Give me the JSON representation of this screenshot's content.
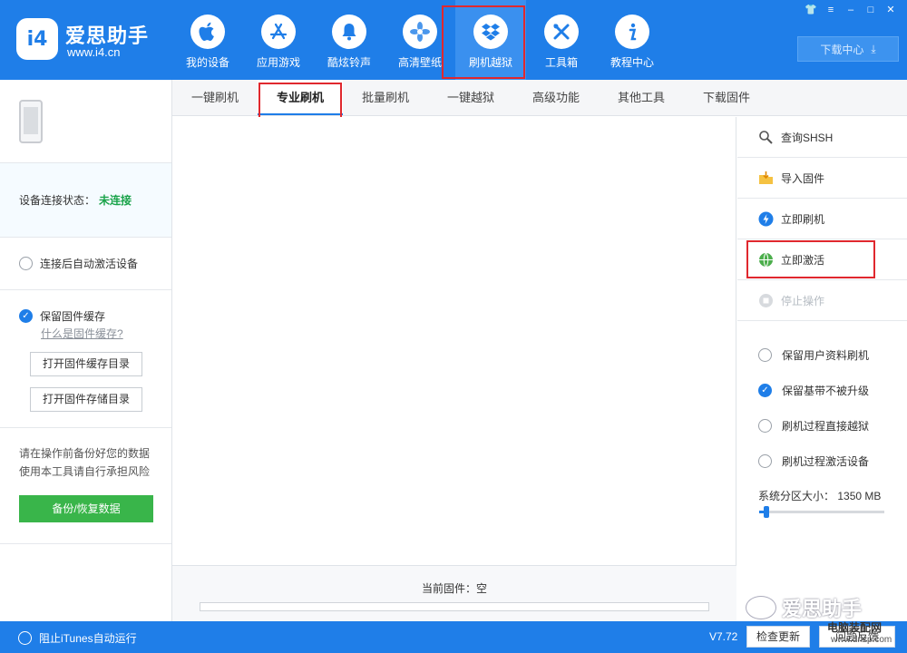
{
  "header": {
    "brand_name": "爱思助手",
    "brand_url": "www.i4.cn",
    "logo_text": "i4",
    "download_center": "下载中心",
    "nav": [
      {
        "label": "我的设备",
        "icon": "apple-icon"
      },
      {
        "label": "应用游戏",
        "icon": "app-store-icon"
      },
      {
        "label": "酷炫铃声",
        "icon": "bell-icon"
      },
      {
        "label": "高清壁纸",
        "icon": "flower-icon"
      },
      {
        "label": "刷机越狱",
        "icon": "dropbox-icon",
        "active": true
      },
      {
        "label": "工具箱",
        "icon": "tools-icon"
      },
      {
        "label": "教程中心",
        "icon": "info-icon"
      }
    ]
  },
  "sidebar": {
    "status_label": "设备连接状态：",
    "status_value": "未连接",
    "auto_activate": "连接后自动激活设备",
    "keep_cache": "保留固件缓存",
    "cache_help": "什么是固件缓存?",
    "open_cache_dir": "打开固件缓存目录",
    "open_storage_dir": "打开固件存储目录",
    "warning_line1": "请在操作前备份好您的数据",
    "warning_line2": "使用本工具请自行承担风险",
    "backup_button": "备份/恢复数据"
  },
  "tabs": [
    "一键刷机",
    "专业刷机",
    "批量刷机",
    "一键越狱",
    "高级功能",
    "其他工具",
    "下载固件"
  ],
  "active_tab": 1,
  "main": {
    "current_firmware": "当前固件：空"
  },
  "right_panel": {
    "actions": [
      {
        "label": "查询SHSH",
        "icon": "shsh-search-icon",
        "disabled": false
      },
      {
        "label": "导入固件",
        "icon": "import-folder-icon",
        "disabled": false
      },
      {
        "label": "立即刷机",
        "icon": "lightning-icon",
        "disabled": false
      },
      {
        "label": "立即激活",
        "icon": "globe-icon",
        "disabled": false
      },
      {
        "label": "停止操作",
        "icon": "stop-icon",
        "disabled": true
      }
    ],
    "options": [
      {
        "label": "保留用户资料刷机",
        "checked": false
      },
      {
        "label": "保留基带不被升级",
        "checked": true
      },
      {
        "label": "刷机过程直接越狱",
        "checked": false
      },
      {
        "label": "刷机过程激活设备",
        "checked": false
      }
    ],
    "partition_label": "系统分区大小：",
    "partition_value": "1350 MB",
    "partition_fraction": 0.06
  },
  "bottom": {
    "itunes_label": "阻止iTunes自动运行",
    "version": "V7.72",
    "check_update": "检查更新",
    "feedback": "问题反馈"
  },
  "watermark": {
    "main": "爱思助手",
    "small": "电脑装配网",
    "url": "www.dnzp.com"
  },
  "colors": {
    "brand_blue": "#1f7ee8",
    "highlight_red": "#e0282e",
    "success_green": "#1aa34a",
    "backup_green": "#39b54a"
  }
}
